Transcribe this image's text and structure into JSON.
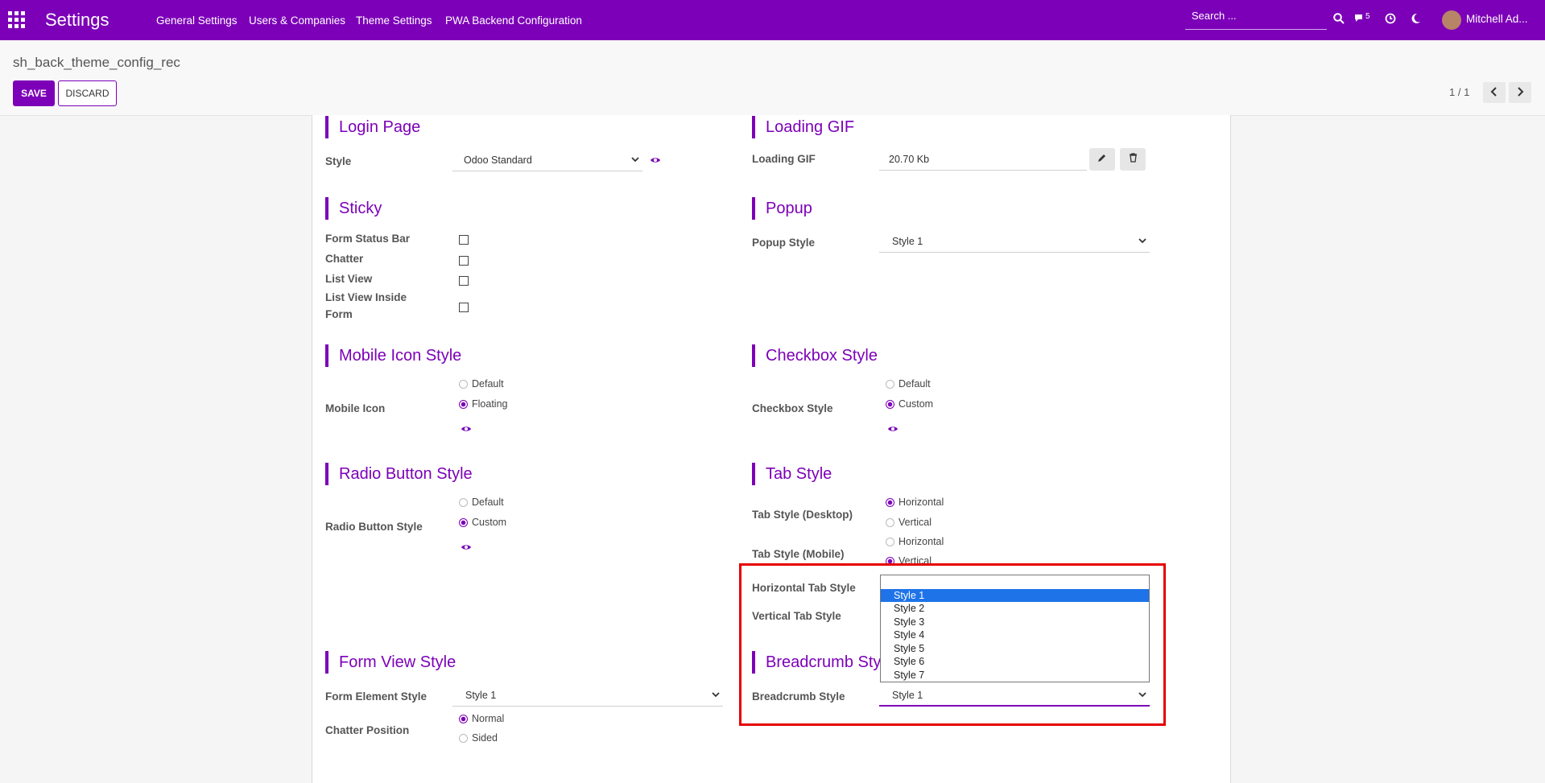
{
  "navbar": {
    "brand": "Settings",
    "menu": [
      "General Settings",
      "Users & Companies",
      "Theme Settings",
      "PWA Backend Configuration"
    ],
    "search_placeholder": "Search ...",
    "notification_count": "5",
    "user_name": "Mitchell Ad...",
    "color": "#7c00b8"
  },
  "control": {
    "title": "sh_back_theme_config_rec",
    "save_label": "SAVE",
    "discard_label": "DISCARD",
    "pager": "1 / 1"
  },
  "login_page": {
    "title": "Login Page",
    "style_label": "Style",
    "style_value": "Odoo Standard"
  },
  "loading_gif": {
    "title": "Loading GIF",
    "label": "Loading GIF",
    "value": "20.70 Kb"
  },
  "sticky": {
    "title": "Sticky",
    "items": [
      "Form Status Bar",
      "Chatter",
      "List View",
      "List View Inside",
      "Form"
    ]
  },
  "popup": {
    "title": "Popup",
    "label": "Popup Style",
    "value": "Style 1"
  },
  "mobile_icon": {
    "title": "Mobile Icon Style",
    "label": "Mobile Icon",
    "options": [
      "Default",
      "Floating"
    ],
    "selected": "Floating"
  },
  "checkbox_style": {
    "title": "Checkbox Style",
    "label": "Checkbox Style",
    "options": [
      "Default",
      "Custom"
    ],
    "selected": "Custom"
  },
  "radio_style": {
    "title": "Radio Button Style",
    "label": "Radio Button Style",
    "options": [
      "Default",
      "Custom"
    ],
    "selected": "Custom"
  },
  "tab_style": {
    "title": "Tab Style",
    "desktop_label": "Tab Style (Desktop)",
    "desktop_options": [
      "Horizontal",
      "Vertical"
    ],
    "mobile_label": "Tab Style (Mobile)",
    "mobile_options": [
      "Horizontal",
      "Vertical"
    ],
    "horizontal_label": "Horizontal Tab Style",
    "vertical_label": "Vertical Tab Style"
  },
  "form_view": {
    "title": "Form View Style",
    "element_label": "Form Element Style",
    "element_value": "Style 1",
    "chatter_label": "Chatter Position",
    "chatter_options": [
      "Normal",
      "Sided"
    ]
  },
  "breadcrumb_style": {
    "title": "Breadcrumb Styl",
    "label": "Breadcrumb Style",
    "value": "Style 1"
  },
  "dropdown": {
    "options": [
      "Style 1",
      "Style 2",
      "Style 3",
      "Style 4",
      "Style 5",
      "Style 6",
      "Style 7"
    ],
    "selected": "Style 1"
  }
}
